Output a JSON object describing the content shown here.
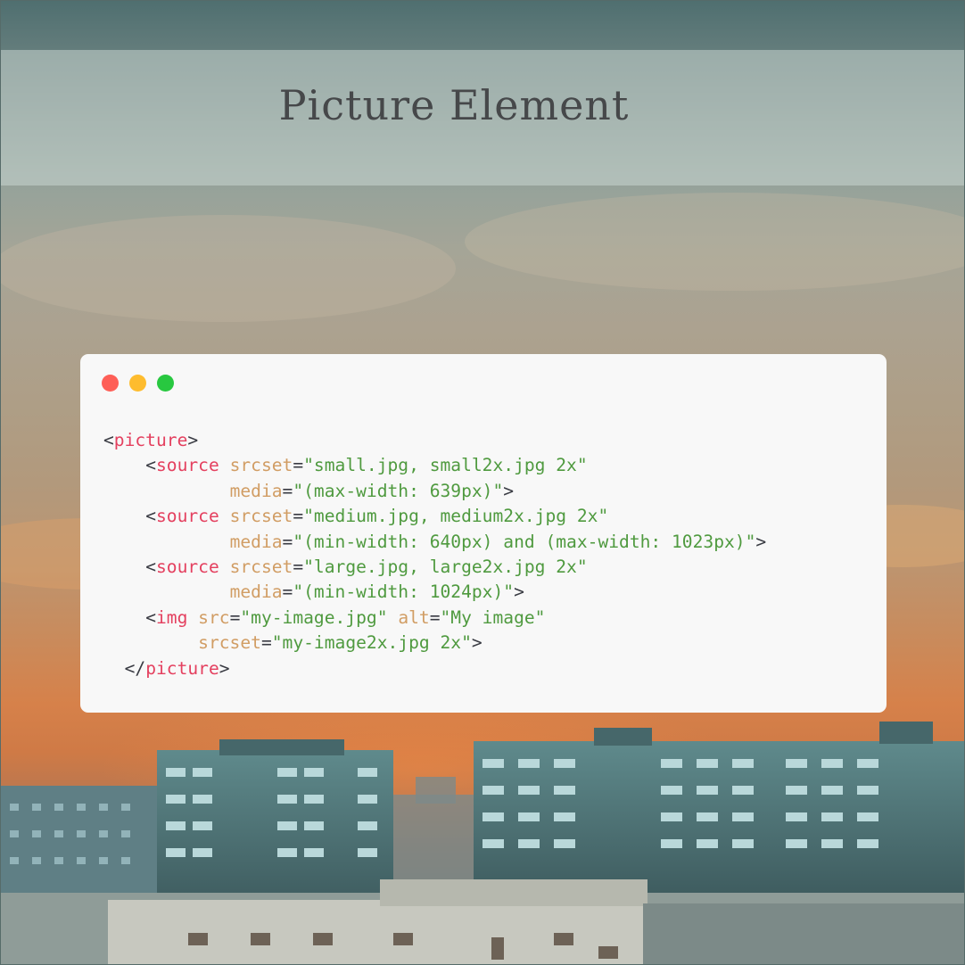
{
  "title": "Picture Element",
  "window_controls": [
    "close",
    "minimize",
    "maximize"
  ],
  "colors": {
    "tag": "#e4405f",
    "attribute": "#d19d64",
    "string": "#4f9a3f",
    "punctuation": "#383a42",
    "window_bg": "#f8f8f8",
    "title_text": "#46484a"
  },
  "code": {
    "lines": [
      {
        "indent": 0,
        "tokens": [
          {
            "t": "<",
            "c": "punct"
          },
          {
            "t": "picture",
            "c": "tag"
          },
          {
            "t": ">",
            "c": "punct"
          }
        ]
      },
      {
        "indent": 4,
        "tokens": [
          {
            "t": "<",
            "c": "punct"
          },
          {
            "t": "source",
            "c": "tag"
          },
          {
            "t": " ",
            "c": "punct"
          },
          {
            "t": "srcset",
            "c": "attr"
          },
          {
            "t": "=",
            "c": "punct"
          },
          {
            "t": "\"small.jpg, small2x.jpg 2x\"",
            "c": "val"
          }
        ]
      },
      {
        "indent": 12,
        "tokens": [
          {
            "t": "media",
            "c": "attr"
          },
          {
            "t": "=",
            "c": "punct"
          },
          {
            "t": "\"(max-width: 639px)\"",
            "c": "val"
          },
          {
            "t": ">",
            "c": "punct"
          }
        ]
      },
      {
        "indent": 4,
        "tokens": [
          {
            "t": "<",
            "c": "punct"
          },
          {
            "t": "source",
            "c": "tag"
          },
          {
            "t": " ",
            "c": "punct"
          },
          {
            "t": "srcset",
            "c": "attr"
          },
          {
            "t": "=",
            "c": "punct"
          },
          {
            "t": "\"medium.jpg, medium2x.jpg 2x\"",
            "c": "val"
          }
        ]
      },
      {
        "indent": 12,
        "tokens": [
          {
            "t": "media",
            "c": "attr"
          },
          {
            "t": "=",
            "c": "punct"
          },
          {
            "t": "\"(min-width: 640px) and (max-width: 1023px)\"",
            "c": "val"
          },
          {
            "t": ">",
            "c": "punct"
          }
        ]
      },
      {
        "indent": 4,
        "tokens": [
          {
            "t": "<",
            "c": "punct"
          },
          {
            "t": "source",
            "c": "tag"
          },
          {
            "t": " ",
            "c": "punct"
          },
          {
            "t": "srcset",
            "c": "attr"
          },
          {
            "t": "=",
            "c": "punct"
          },
          {
            "t": "\"large.jpg, large2x.jpg 2x\"",
            "c": "val"
          }
        ]
      },
      {
        "indent": 12,
        "tokens": [
          {
            "t": "media",
            "c": "attr"
          },
          {
            "t": "=",
            "c": "punct"
          },
          {
            "t": "\"(min-width: 1024px)\"",
            "c": "val"
          },
          {
            "t": ">",
            "c": "punct"
          }
        ]
      },
      {
        "indent": 4,
        "tokens": [
          {
            "t": "<",
            "c": "punct"
          },
          {
            "t": "img",
            "c": "tag"
          },
          {
            "t": " ",
            "c": "punct"
          },
          {
            "t": "src",
            "c": "attr"
          },
          {
            "t": "=",
            "c": "punct"
          },
          {
            "t": "\"my-image.jpg\"",
            "c": "val"
          },
          {
            "t": " ",
            "c": "punct"
          },
          {
            "t": "alt",
            "c": "attr"
          },
          {
            "t": "=",
            "c": "punct"
          },
          {
            "t": "\"My image\"",
            "c": "val"
          }
        ]
      },
      {
        "indent": 9,
        "tokens": [
          {
            "t": "srcset",
            "c": "attr"
          },
          {
            "t": "=",
            "c": "punct"
          },
          {
            "t": "\"my-image2x.jpg 2x\"",
            "c": "val"
          },
          {
            "t": ">",
            "c": "punct"
          }
        ]
      },
      {
        "indent": 2,
        "tokens": [
          {
            "t": "</",
            "c": "punct"
          },
          {
            "t": "picture",
            "c": "tag"
          },
          {
            "t": ">",
            "c": "punct"
          }
        ]
      }
    ]
  }
}
